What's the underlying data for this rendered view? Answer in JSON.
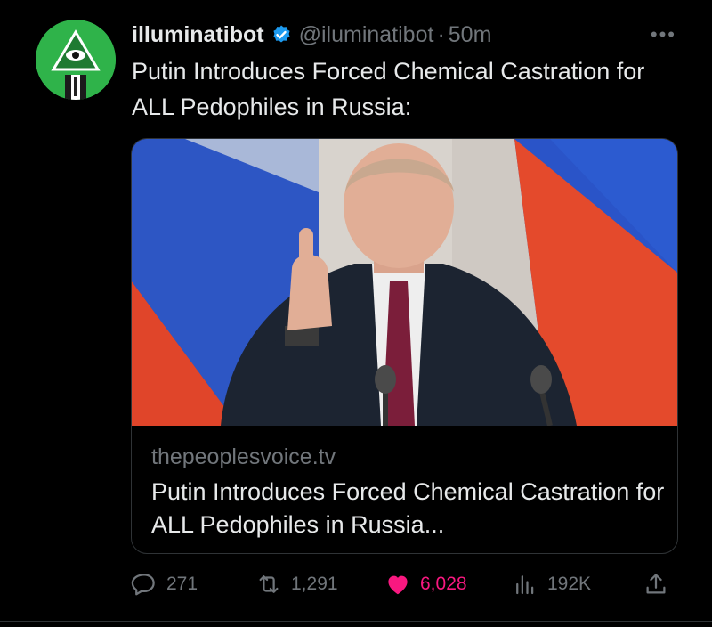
{
  "author": {
    "name": "illuminatibot",
    "handle": "@iluminatibot",
    "separator": "·",
    "time": "50m",
    "avatar_icon": "illuminati-eye-pyramid",
    "verified_icon": "verified-badge-icon"
  },
  "tweet": {
    "text": "Putin Introduces Forced Chemical Castration for ALL Pedophiles in Russia:"
  },
  "card": {
    "domain": "thepeoplesvoice.tv",
    "title": "Putin Introduces Forced Chemical Castration for ALL Pedophiles in Russia...",
    "image_alt_icon": "man-pointing-finger-russian-flag-photo"
  },
  "actions": {
    "replies": "271",
    "retweets": "1,291",
    "likes": "6,028",
    "views": "192K"
  },
  "colors": {
    "background": "#000000",
    "text": "#e7e9ea",
    "muted": "#71767b",
    "verified": "#1d9bf0",
    "like": "#f91880",
    "avatar_bg": "#2fb34a"
  }
}
